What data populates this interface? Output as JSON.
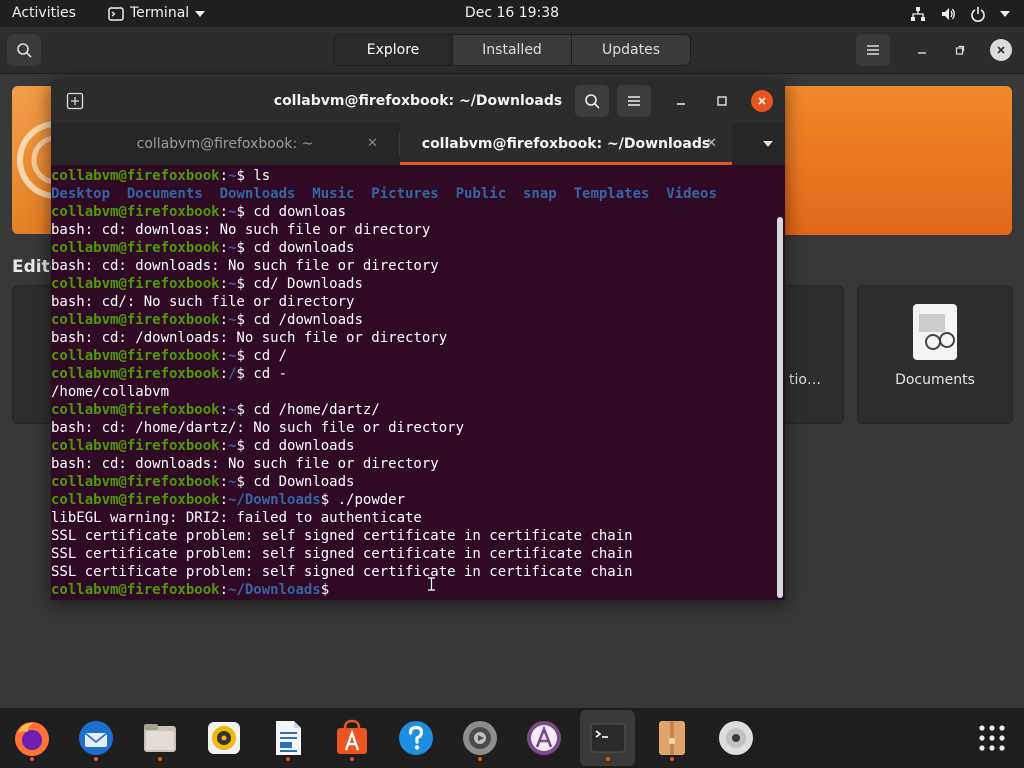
{
  "topbar": {
    "activities": "Activities",
    "app_name": "Terminal",
    "clock": "Dec 16  19:38"
  },
  "software": {
    "tabs": [
      "Explore",
      "Installed",
      "Updates"
    ],
    "editors_partial": "Edito",
    "card_partial_label": "tio…",
    "documents_label": "Documents"
  },
  "terminal": {
    "title": "collabvm@firefoxbook: ~/Downloads",
    "tab1": "collabvm@firefoxbook: ~",
    "tab2": "collabvm@firefoxbook: ~/Downloads",
    "prompt_user": "collabvm@firefoxbook",
    "lines": {
      "l0": {
        "path": "~",
        "cmd": " ls"
      },
      "ls_output": "Desktop  Documents  Downloads  Music  Pictures  Public  snap  Templates  Videos",
      "l2": {
        "path": "~",
        "cmd": " cd downloas"
      },
      "l3": "bash: cd: downloas: No such file or directory",
      "l4": {
        "path": "~",
        "cmd": " cd downloads"
      },
      "l5": "bash: cd: downloads: No such file or directory",
      "l6": {
        "path": "~",
        "cmd": " cd/ Downloads"
      },
      "l7": "bash: cd/: No such file or directory",
      "l8": {
        "path": "~",
        "cmd": " cd /downloads"
      },
      "l9": "bash: cd: /downloads: No such file or directory",
      "l10": {
        "path": "~",
        "cmd": " cd /"
      },
      "l11": {
        "path": "/",
        "cmd": " cd -"
      },
      "l12": "/home/collabvm",
      "l13": {
        "path": "~",
        "cmd": " cd /home/dartz/"
      },
      "l14": "bash: cd: /home/dartz/: No such file or directory",
      "l15": {
        "path": "~",
        "cmd": " cd downloads"
      },
      "l16": "bash: cd: downloads: No such file or directory",
      "l17": {
        "path": "~",
        "cmd": " cd Downloads"
      },
      "l18": {
        "path": "~/Downloads",
        "cmd": " ./powder"
      },
      "l19": "libEGL warning: DRI2: failed to authenticate",
      "l20": "SSL certificate problem: self signed certificate in certificate chain",
      "l21": "SSL certificate problem: self signed certificate in certificate chain",
      "l22": "SSL certificate problem: self signed certificate in certificate chain",
      "l23": {
        "path": "~/Downloads",
        "cmd": " "
      }
    }
  },
  "colors": {
    "terminal_bg": "#300a24",
    "prompt_user": "#4e9a06",
    "prompt_path": "#3465a4",
    "accent": "#e95420"
  },
  "dock": {
    "icons": [
      "firefox-icon",
      "thunderbird-icon",
      "files-icon",
      "rhythmbox-icon",
      "writer-icon",
      "software-icon",
      "help-icon",
      "settings-icon",
      "app-icon",
      "terminal-icon",
      "archive-icon",
      "disc-icon",
      "app-grid-icon"
    ]
  }
}
